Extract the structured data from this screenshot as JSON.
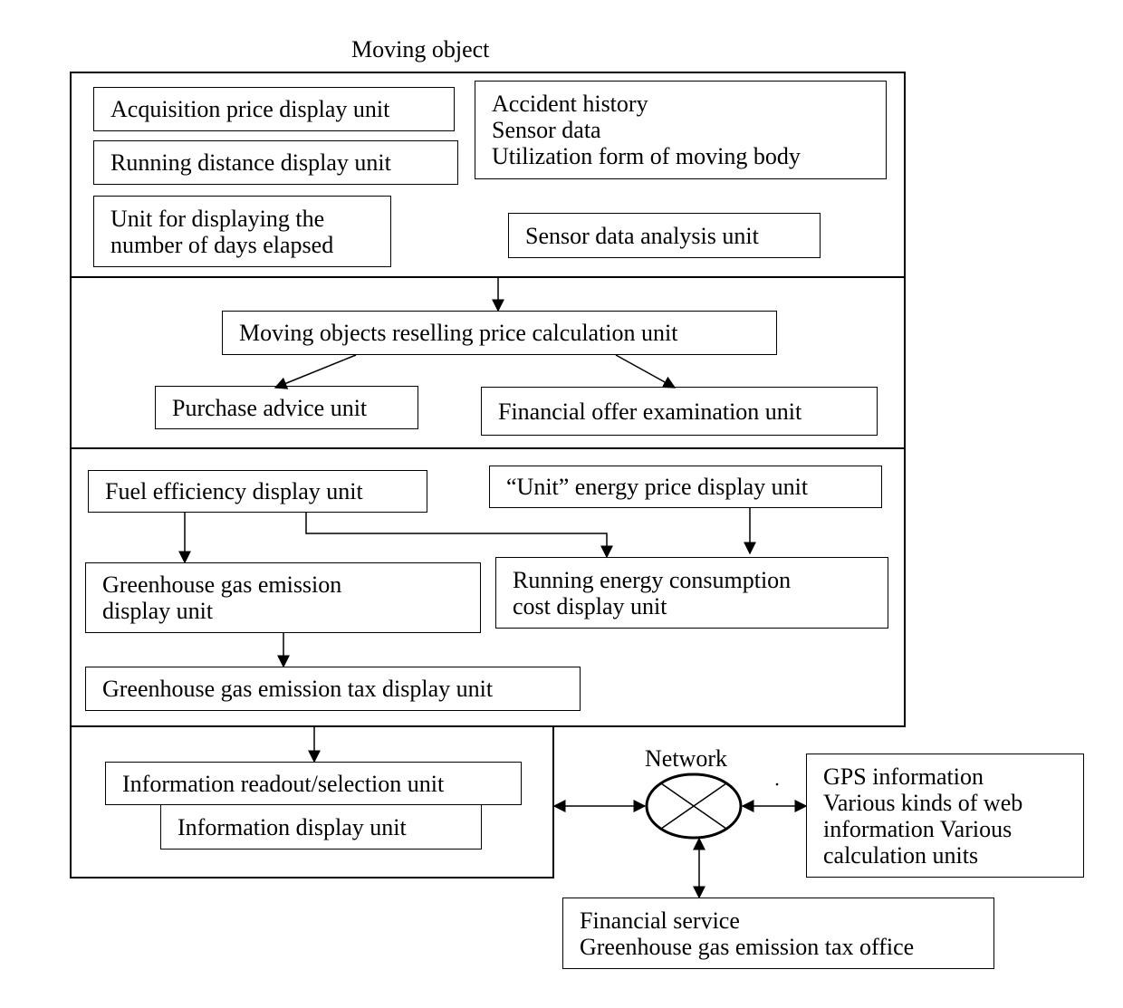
{
  "title": "Moving object",
  "sections": {
    "top": {
      "acquisition_price": "Acquisition price display unit",
      "running_distance": "Running distance display unit",
      "days_elapsed": [
        "Unit for displaying the",
        "number of days elapsed"
      ],
      "history_info": [
        "Accident history",
        "Sensor data",
        "Utilization form of moving body"
      ],
      "sensor_analysis": "Sensor data analysis unit"
    },
    "pricing": {
      "reselling_price": "Moving objects reselling price calculation unit",
      "purchase_advice": "Purchase advice unit",
      "financial_offer": "Financial offer examination unit"
    },
    "energy": {
      "fuel_efficiency": "Fuel efficiency display unit",
      "unit_energy_price": "“Unit” energy price display unit",
      "ghg_emission": [
        "Greenhouse gas emission",
        "display unit"
      ],
      "running_energy_cost": [
        "Running energy consumption",
        "cost display unit"
      ],
      "ghg_tax": "Greenhouse gas emission tax display unit"
    },
    "info": {
      "readout_selection": "Information readout/selection unit",
      "display": "Information display unit"
    }
  },
  "network": {
    "label": "Network",
    "external_info": [
      "GPS information",
      "Various kinds of web",
      "information Various",
      "calculation units"
    ],
    "financial": [
      "Financial service",
      "Greenhouse gas emission tax office"
    ]
  }
}
